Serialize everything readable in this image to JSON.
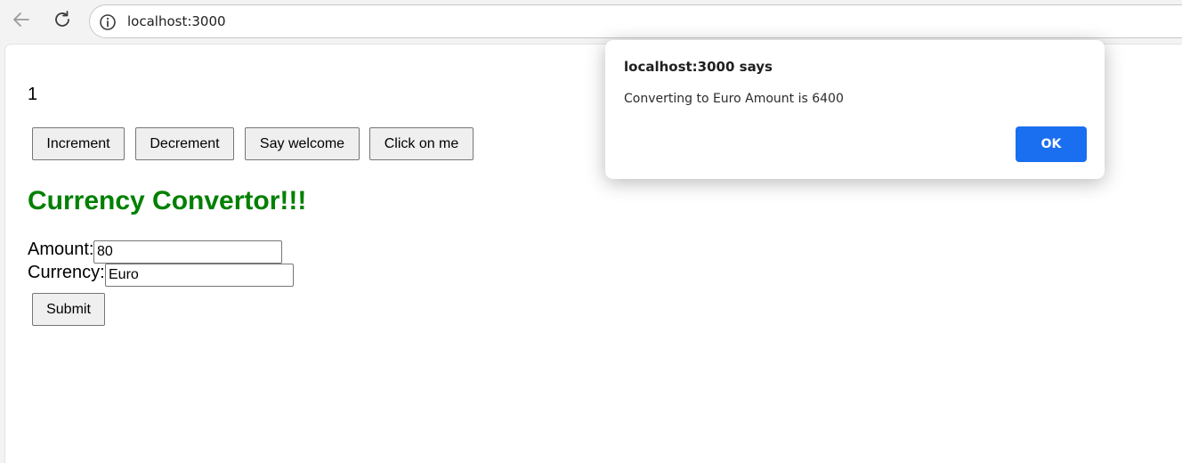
{
  "browser": {
    "url": "localhost:3000",
    "icons": {
      "back": "arrow-left-icon",
      "reload": "reload-icon",
      "site_info": "info-icon"
    }
  },
  "page": {
    "counter": "1",
    "buttons": {
      "increment": "Increment",
      "decrement": "Decrement",
      "say_welcome": "Say welcome",
      "click_on_me": "Click on me"
    },
    "heading": "Currency Convertor!!!",
    "heading_color": "#008000",
    "form": {
      "amount_label": "Amount:",
      "amount_value": "80",
      "currency_label": "Currency:",
      "currency_value": "Euro",
      "submit_label": "Submit"
    }
  },
  "dialog": {
    "title": "localhost:3000 says",
    "message": "Converting to Euro Amount is 6400",
    "ok_label": "OK",
    "ok_color": "#1a6ff0"
  }
}
